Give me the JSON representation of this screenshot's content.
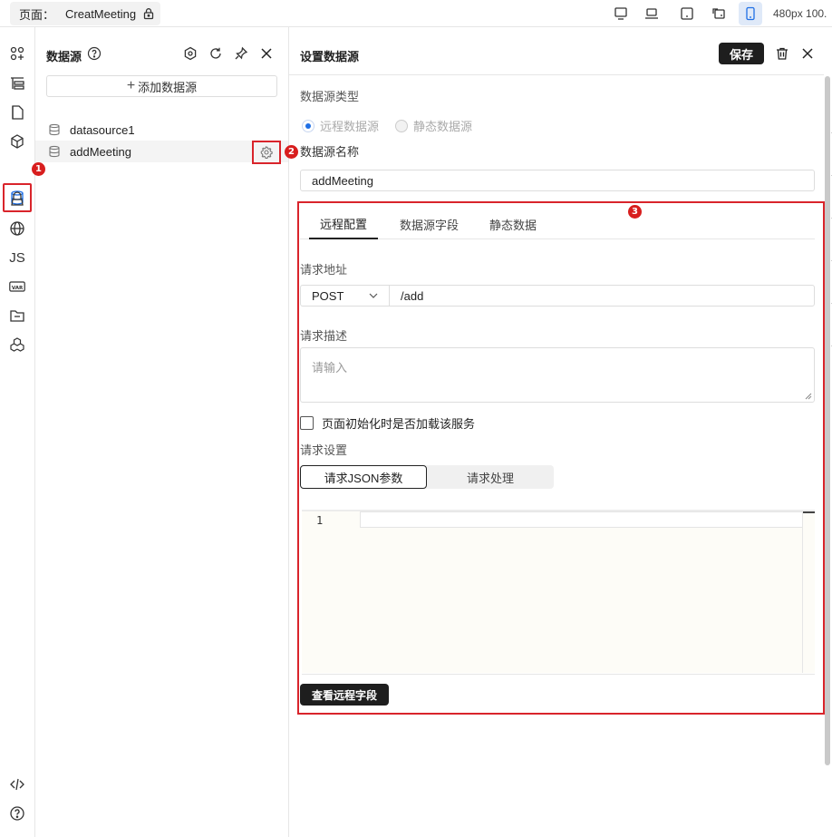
{
  "topbar": {
    "page_label": "页面：",
    "page_name": "CreatMeeting",
    "size_text": "480px  100."
  },
  "rail": {
    "js_label": "JS",
    "var_label": "VAR",
    "markers": {
      "m1": "1",
      "m2": "2",
      "m3": "3"
    }
  },
  "datasource_panel": {
    "title": "数据源",
    "add_button": "添加数据源",
    "items": [
      {
        "name": "datasource1"
      },
      {
        "name": "addMeeting"
      }
    ]
  },
  "settings_panel": {
    "title": "设置数据源",
    "save_label": "保存",
    "type_label": "数据源类型",
    "type_options": [
      "远程数据源",
      "静态数据源"
    ],
    "selected_type": "远程数据源",
    "name_label": "数据源名称",
    "name_value": "addMeeting",
    "tabs": [
      "远程配置",
      "数据源字段",
      "静态数据"
    ],
    "active_tab": "远程配置",
    "url_label": "请求地址",
    "method": "POST",
    "url_value": "/add",
    "desc_label": "请求描述",
    "desc_placeholder": "请输入",
    "init_checkbox_label": "页面初始化时是否加载该服务",
    "init_checked": false,
    "request_settings_label": "请求设置",
    "request_tabs": [
      "请求JSON参数",
      "请求处理"
    ],
    "active_request_tab": "请求JSON参数",
    "editor_line": "1",
    "view_fields_button": "查看远程字段"
  },
  "colors": {
    "accent_red": "#d9242b",
    "primary_dark": "#1e1e1e",
    "radio_blue": "#1f6fe5",
    "active_device_bg": "#dfe9f8"
  }
}
